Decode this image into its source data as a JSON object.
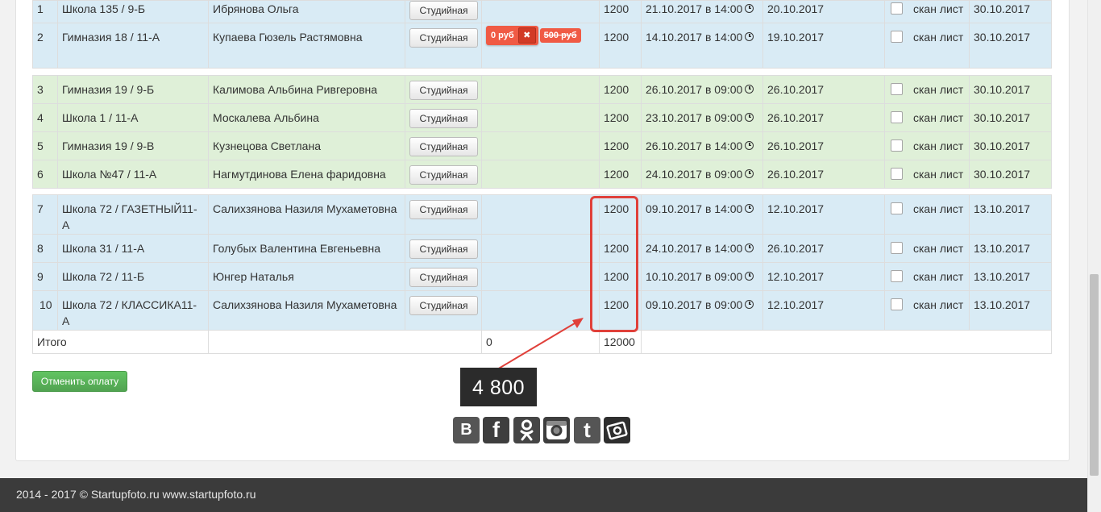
{
  "rows": [
    {
      "num": "1",
      "school": "Школа 135 / 9-Б",
      "name": "Ибрянова Ольга",
      "type": "Студийная",
      "price": "1200",
      "shoot": "21.10.2017 в 14:00",
      "date": "20.10.2017",
      "scan": "скан лист",
      "deadline": "30.10.2017"
    },
    {
      "num": "2",
      "school": "Гимназия 18 / 11-А",
      "name": "Купаева Гюзель Растямовна",
      "type": "Студийная",
      "payment": "0 руб",
      "old_payment": "500 руб",
      "price": "1200",
      "shoot": "14.10.2017 в 14:00",
      "date": "19.10.2017",
      "scan": "скан лист",
      "deadline": "30.10.2017"
    },
    {
      "num": "3",
      "school": "Гимназия 19 / 9-Б",
      "name": "Калимова Альбина Ривгеровна",
      "type": "Студийная",
      "price": "1200",
      "shoot": "26.10.2017 в 09:00",
      "date": "26.10.2017",
      "scan": "скан лист",
      "deadline": "30.10.2017"
    },
    {
      "num": "4",
      "school": "Школа 1 / 11-А",
      "name": "Москалева Альбина",
      "type": "Студийная",
      "price": "1200",
      "shoot": "23.10.2017 в 09:00",
      "date": "26.10.2017",
      "scan": "скан лист",
      "deadline": "30.10.2017"
    },
    {
      "num": "5",
      "school": "Гимназия 19 / 9-В",
      "name": "Кузнецова Светлана",
      "type": "Студийная",
      "price": "1200",
      "shoot": "26.10.2017 в 14:00",
      "date": "26.10.2017",
      "scan": "скан лист",
      "deadline": "30.10.2017"
    },
    {
      "num": "6",
      "school": "Школа №47 / 11-А",
      "name": "Нагмутдинова Елена фаридовна",
      "type": "Студийная",
      "price": "1200",
      "shoot": "24.10.2017 в 09:00",
      "date": "26.10.2017",
      "scan": "скан лист",
      "deadline": "30.10.2017"
    },
    {
      "num": "7",
      "school": "Школа 72 / ГАЗЕТНЫЙ11-А",
      "name": "Салихзянова Назиля Мухаметовна",
      "type": "Студийная",
      "price": "1200",
      "shoot": "09.10.2017 в 14:00",
      "date": "12.10.2017",
      "scan": "скан лист",
      "deadline": "13.10.2017"
    },
    {
      "num": "8",
      "school": "Школа 31 / 11-А",
      "name": "Голубых Валентина Евгеньевна",
      "type": "Студийная",
      "price": "1200",
      "shoot": "24.10.2017 в 14:00",
      "date": "26.10.2017",
      "scan": "скан лист",
      "deadline": "13.10.2017"
    },
    {
      "num": "9",
      "school": "Школа 72 / 11-Б",
      "name": "Юнгер Наталья",
      "type": "Студийная",
      "price": "1200",
      "shoot": "10.10.2017 в 09:00",
      "date": "12.10.2017",
      "scan": "скан лист",
      "deadline": "13.10.2017"
    },
    {
      "num": "10",
      "school": "Школа 72 / КЛАССИКА11-А",
      "name": "Салихзянова Назиля Мухаметовна",
      "type": "Студийная",
      "price": "1200",
      "shoot": "09.10.2017 в 09:00",
      "date": "12.10.2017",
      "scan": "скан лист",
      "deadline": "13.10.2017"
    }
  ],
  "total": {
    "label": "Итого",
    "paid": "0",
    "sum": "12000"
  },
  "cancel_button": "Отменить оплату",
  "tooltip_value": "4 800",
  "social": {
    "vk": "В",
    "fb": "f",
    "tw": "t"
  },
  "icons": {
    "clock": "clock-icon",
    "close": "close-icon",
    "ok": "odnoklassniki-icon",
    "ig": "instagram-icon",
    "ph": "photo-icon"
  },
  "colors": {
    "blue_row": "#d9ebf5",
    "green_row": "#dff0d8",
    "accent_red": "#e0403a",
    "green_button": "#5cb85c",
    "footer_bg": "#3b3b3b"
  },
  "footer": {
    "text": "2014 - 2017 © Startupfoto.ru www.startupfoto.ru"
  }
}
